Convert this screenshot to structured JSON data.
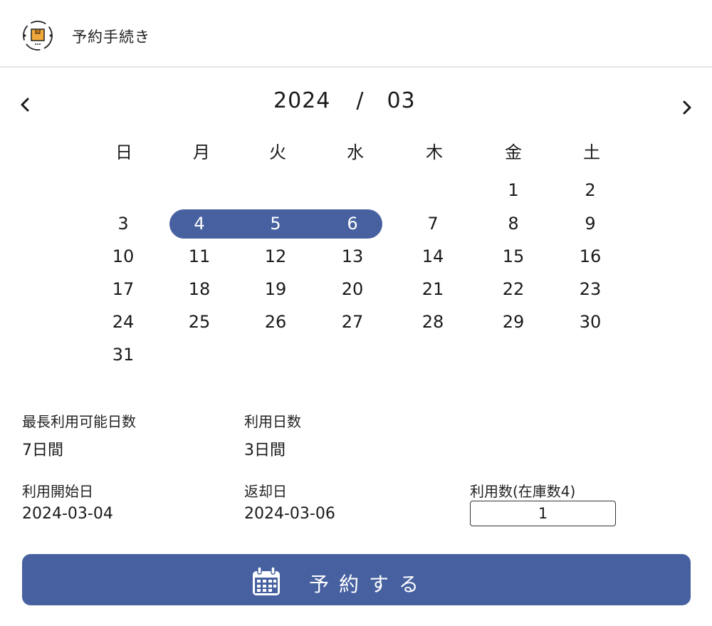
{
  "header": {
    "title": "予約手続き",
    "logo_icon": "box-cycle-icon"
  },
  "calendar": {
    "year": "2024",
    "separator": "/",
    "month": "03",
    "prev_icon": "chevron-left-icon",
    "next_icon": "chevron-right-icon",
    "weekdays": [
      "日",
      "月",
      "火",
      "水",
      "木",
      "金",
      "土"
    ],
    "first_weekday_index": 5,
    "days_in_month": 31,
    "selected_range": [
      4,
      6
    ],
    "accent_color": "#4761a0"
  },
  "info": {
    "max_days_label": "最長利用可能日数",
    "max_days_value": "7日間",
    "usage_days_label": "利用日数",
    "usage_days_value": "3日間",
    "start_label": "利用開始日",
    "start_value": "2024-03-04",
    "return_label": "返却日",
    "return_value": "2024-03-06",
    "quantity_label": "利用数(在庫数4)",
    "quantity_value": "1"
  },
  "button": {
    "label": "予約する",
    "icon": "calendar-icon"
  }
}
